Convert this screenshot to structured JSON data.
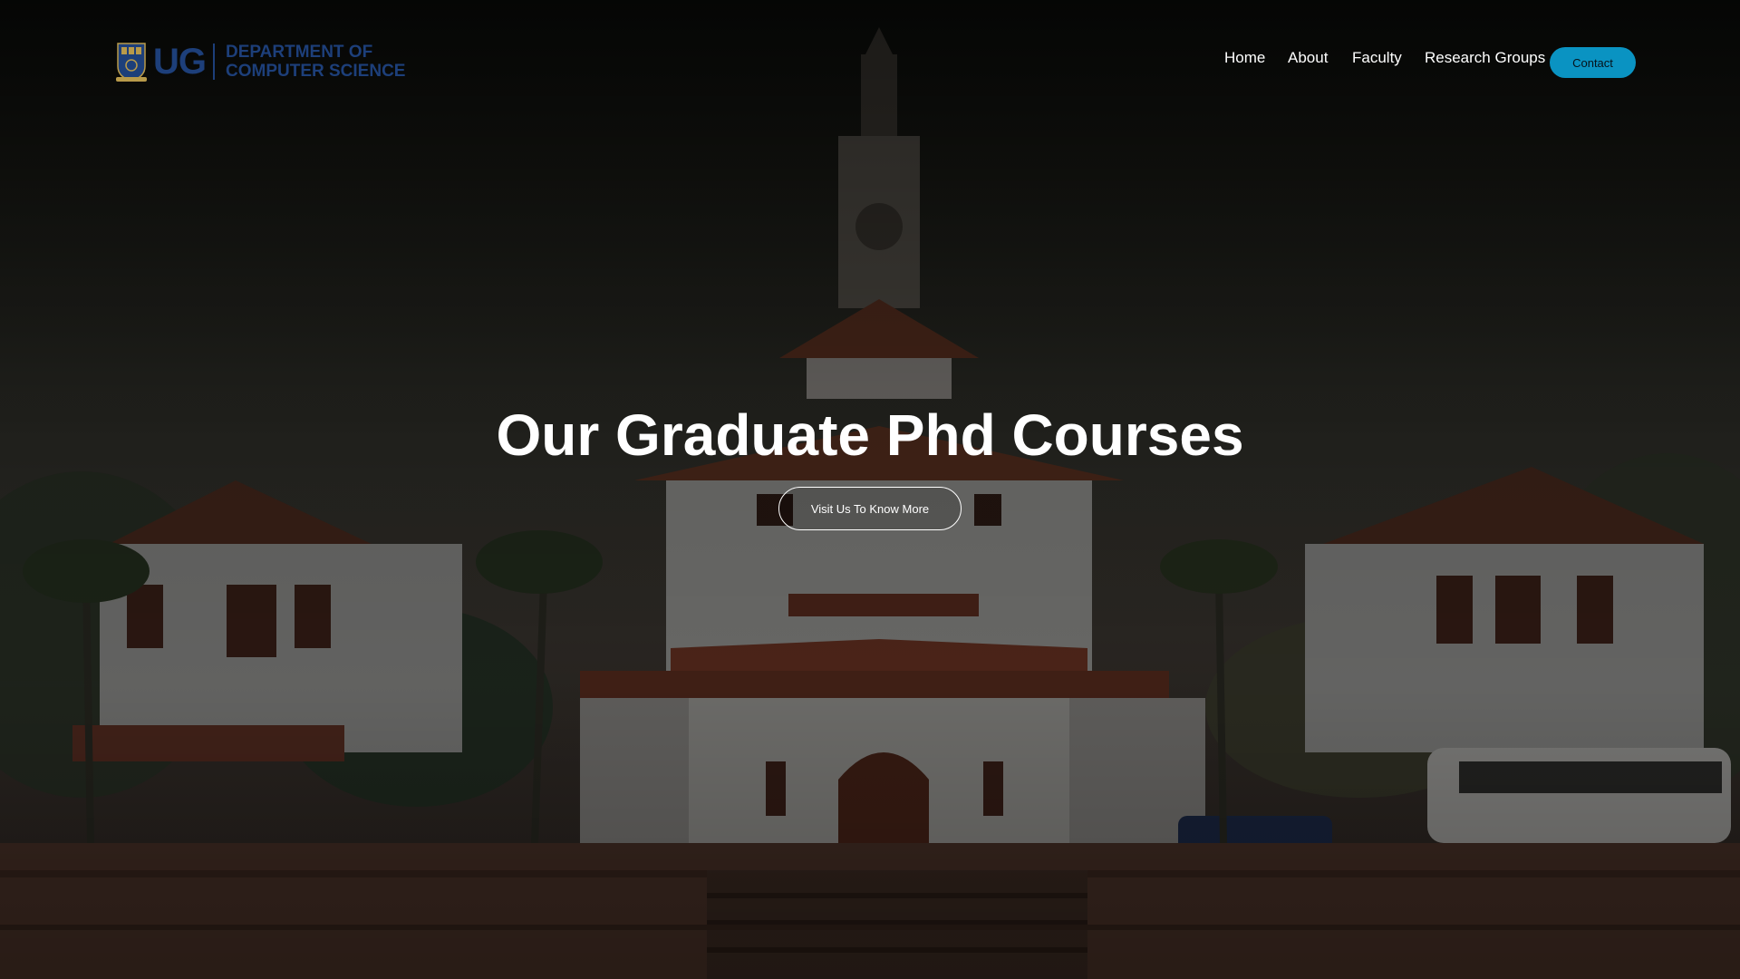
{
  "brand": {
    "short": "UG",
    "line1": "DEPARTMENT OF",
    "line2": "COMPUTER SCIENCE",
    "color": "#1d3f7a"
  },
  "nav": {
    "items": [
      {
        "label": "Home"
      },
      {
        "label": "About"
      },
      {
        "label": "Faculty"
      },
      {
        "label": "Research Groups"
      }
    ],
    "contact_label": "Contact",
    "contact_color": "#0a93c2"
  },
  "hero": {
    "title": "Our Graduate Phd Courses",
    "cta_label": "Visit Us To Know More",
    "background": "university-clock-tower-building-photo"
  }
}
